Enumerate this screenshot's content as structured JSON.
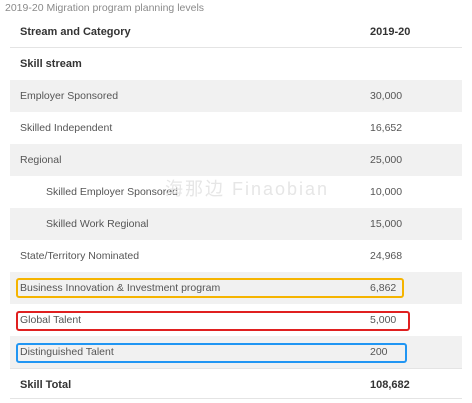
{
  "caption": "2019-20 Migration program planning levels",
  "table": {
    "headers": {
      "category": "Stream and Category",
      "value": "2019-20"
    },
    "section_label": "Skill stream",
    "rows": [
      {
        "category": "Employer Sponsored",
        "value": "30,000"
      },
      {
        "category": "Skilled Independent",
        "value": "16,652"
      },
      {
        "category": "Regional",
        "value": "25,000"
      },
      {
        "category": "Skilled Employer Sponsored",
        "value": "10,000"
      },
      {
        "category": "Skilled Work Regional",
        "value": "15,000"
      },
      {
        "category": "State/Territory Nominated",
        "value": "24,968"
      },
      {
        "category": "Business Innovation & Investment program",
        "value": "6,862"
      },
      {
        "category": "Global Talent",
        "value": "5,000"
      },
      {
        "category": "Distinguished Talent",
        "value": "200"
      }
    ],
    "total": {
      "category": "Skill Total",
      "value": "108,682"
    }
  },
  "highlights": {
    "business_color": "#f5b400",
    "global_color": "#e02020",
    "distinguished_color": "#2196f3"
  },
  "watermark": "海那边 Finaobian"
}
